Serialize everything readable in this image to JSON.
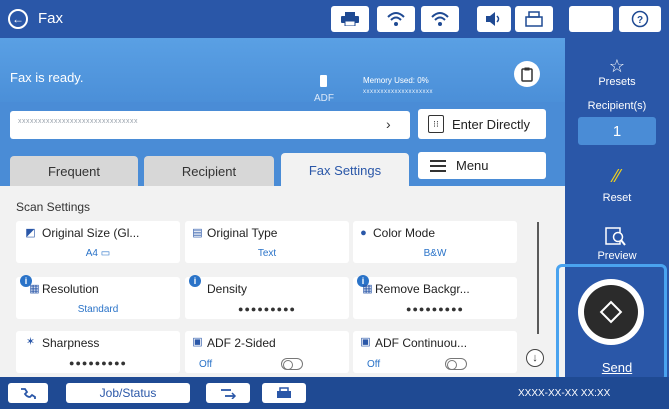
{
  "header": {
    "back_glyph": "←",
    "title": "Fax",
    "icons": [
      "printer-icon",
      "wifi-direct-icon",
      "wifi-icon",
      "volume-icon",
      "fax-network-icon",
      "sleep-icon",
      "help-icon"
    ]
  },
  "status": {
    "message": "Fax is ready.",
    "adf_label": "ADF",
    "memory_label": "Memory Used: 0%",
    "memory_bar": "xxxxxxxxxxxxxxxxxxxx"
  },
  "recipient": {
    "value": "xxxxxxxxxxxxxxxxxxxxxxxxxxxxxx",
    "arrow": "›",
    "enter_directly_label": "Enter Directly"
  },
  "tabs": [
    {
      "label": "Frequent"
    },
    {
      "label": "Recipient"
    },
    {
      "label": "Fax Settings",
      "active": true
    }
  ],
  "menu_label": "Menu",
  "scan_settings": {
    "heading": "Scan Settings",
    "items": [
      {
        "label": "Original Size (Gl...",
        "value": "A4 ▭"
      },
      {
        "label": "Original Type",
        "value": "Text"
      },
      {
        "label": "Color Mode",
        "value": "B&W"
      },
      {
        "label": "Resolution",
        "value": "Standard"
      },
      {
        "label": "Density",
        "value": "●●●●●●●●●"
      },
      {
        "label": "Remove Backgr...",
        "value": "●●●●●●●●●"
      },
      {
        "label": "Sharpness",
        "value": "●●●●●●●●●"
      },
      {
        "label": "ADF 2-Sided",
        "value": "Off"
      },
      {
        "label": "ADF Continuou...",
        "value": "Off"
      }
    ]
  },
  "sidebar": {
    "presets_label": "Presets",
    "recipients_label": "Recipient(s)",
    "recipients_count": "1",
    "reset_label": "Reset",
    "preview_label": "Preview",
    "send_label": "Send"
  },
  "footer": {
    "job_status_label": "Job/Status",
    "fax_number": "XXXX-XX-XX XX:XX"
  },
  "colors": {
    "accent": "#2a57a8",
    "status_bg": "#4b8fd8",
    "send_frame": "#4aa3ef",
    "reset_icon": "#f2d21b"
  }
}
